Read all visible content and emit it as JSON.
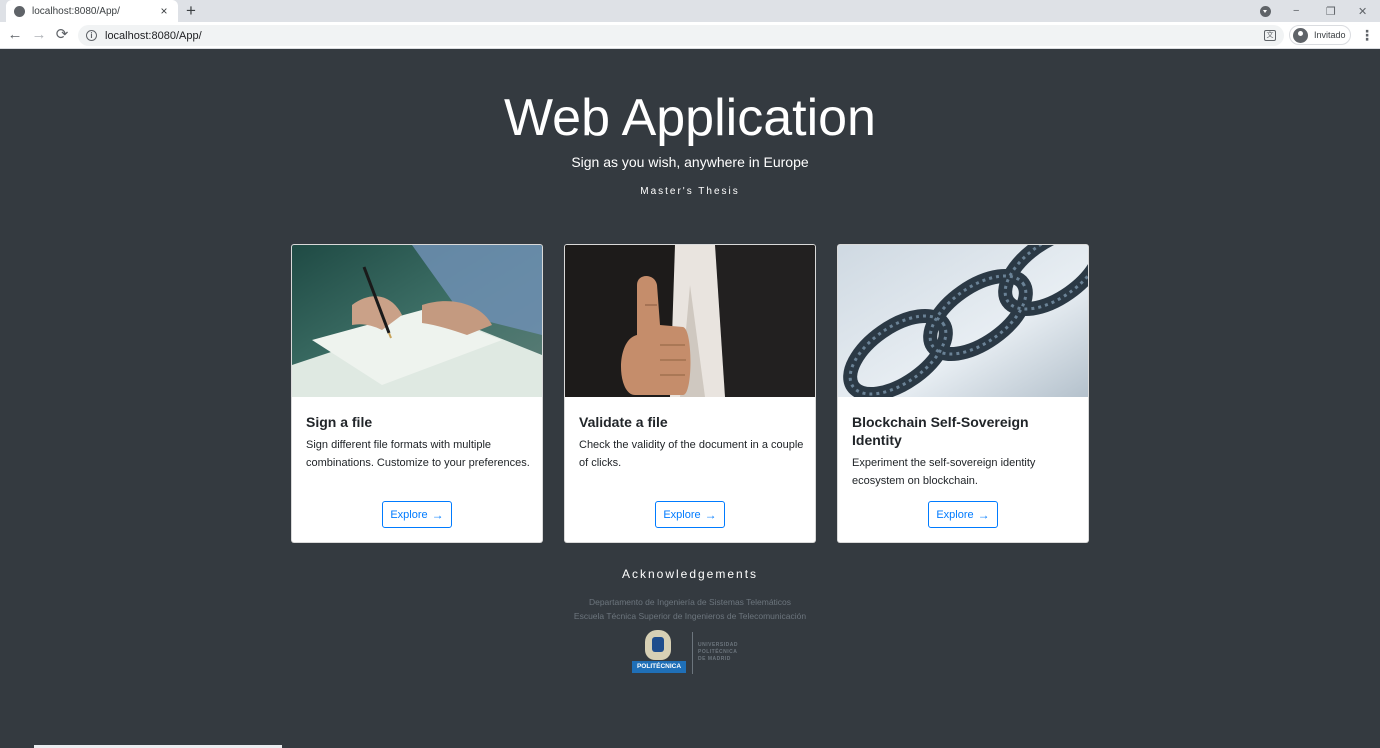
{
  "browser": {
    "tab_title": "localhost:8080/App/",
    "tab_close": "×",
    "new_tab": "+",
    "url": "localhost:8080/App/",
    "profile_label": "Invitado",
    "controls": {
      "minimize": "−",
      "restore": "❐",
      "close": "✕"
    },
    "back": "←",
    "forward": "→",
    "reload": "⟳",
    "menu": "⋮"
  },
  "hero": {
    "title": "Web Application",
    "subtitle": "Sign as you wish, anywhere in Europe",
    "tag": "Master's Thesis"
  },
  "cards": [
    {
      "title": "Sign a file",
      "text": "Sign different file formats with multiple combinations. Customize to your preferences.",
      "button": "Explore",
      "image": "hand-signing-document"
    },
    {
      "title": "Validate a file",
      "text": "Check the validity of the document in a couple of clicks.",
      "button": "Explore",
      "image": "businessman-thumbs-up"
    },
    {
      "title": "Blockchain Self-Sovereign Identity",
      "text": "Experiment the self-sovereign identity ecosystem on blockchain.",
      "button": "Explore",
      "image": "digital-chain-links"
    }
  ],
  "acknowledgements": {
    "title": "Acknowledgements",
    "line1": "Departamento de Ingeniería de Sistemas Telemáticos",
    "line2": "Escuela Técnica Superior de Ingenieros de Telecomunicación",
    "logo_band": "POLITÉCNICA",
    "logo_words": [
      "UNIVERSIDAD",
      "POLITÉCNICA",
      "DE MADRID"
    ]
  },
  "colors": {
    "page_bg": "#343a40",
    "accent": "#007bff",
    "card_bg": "#ffffff"
  }
}
